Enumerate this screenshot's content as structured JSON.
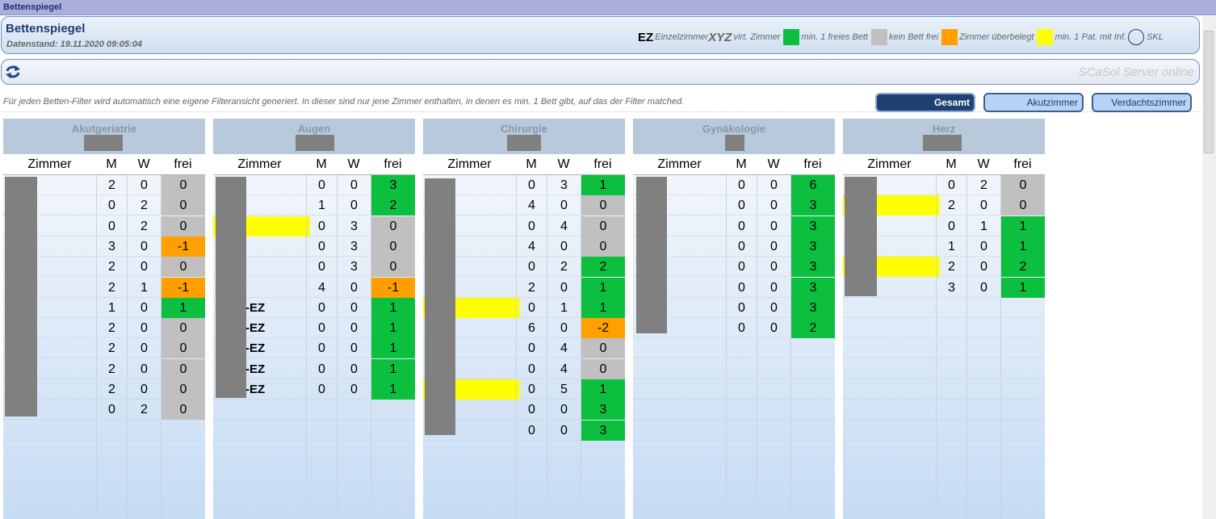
{
  "window": {
    "title": "Bettenspiegel"
  },
  "header": {
    "title": "Bettenspiegel",
    "datestand": "Datenstand: 19.11.2020 09:05:04"
  },
  "legend": {
    "ez_code": "EZ",
    "ez_label": "Einzelzimmer",
    "xyz_code": "XYZ",
    "xyz_label": "virt. Zimmer",
    "green_label": "min. 1 freies Bett",
    "gray_label": "kein Bett frei",
    "orange_label": "Zimmer überbelegt",
    "yellow_label": "min. 1 Pat. mit Inf.",
    "skl_label": "SKL",
    "colors": {
      "green": "#0cbf3f",
      "gray": "#c0c0c0",
      "orange": "#ff9f00",
      "yellow": "#ffff00"
    }
  },
  "toolbar": {
    "refresh_icon": "refresh-icon",
    "server_status": "SCaSol Server online"
  },
  "info_text": "Für jeden Betten-Filter wird automatisch eine eigene Filteransicht generiert. In dieser sind nur jene Zimmer enthalten, in denen es min. 1 Bett gibt, auf das der Filter matched.",
  "filters": {
    "gesamt": "Gesamt",
    "akutzimmer": "Akutzimmer",
    "verdachtszimmer": "Verdachtszimmer",
    "selected": "Gesamt"
  },
  "columns": {
    "room": "Zimmer",
    "m": "M",
    "w": "W",
    "free": "frei"
  },
  "wards": [
    {
      "name": "Akutgeriatrie",
      "rows": [
        {
          "m": "2",
          "w": "0",
          "free": "0",
          "status": "gray",
          "room": "",
          "inf": false
        },
        {
          "m": "0",
          "w": "2",
          "free": "0",
          "status": "gray",
          "room": "",
          "inf": false
        },
        {
          "m": "0",
          "w": "2",
          "free": "0",
          "status": "gray",
          "room": "",
          "inf": false
        },
        {
          "m": "3",
          "w": "0",
          "free": "-1",
          "status": "orange",
          "room": "",
          "inf": false
        },
        {
          "m": "2",
          "w": "0",
          "free": "0",
          "status": "gray",
          "room": "",
          "inf": false
        },
        {
          "m": "2",
          "w": "1",
          "free": "-1",
          "status": "orange",
          "room": "",
          "inf": false
        },
        {
          "m": "1",
          "w": "0",
          "free": "1",
          "status": "green",
          "room": "",
          "inf": false
        },
        {
          "m": "2",
          "w": "0",
          "free": "0",
          "status": "gray",
          "room": "",
          "inf": false
        },
        {
          "m": "2",
          "w": "0",
          "free": "0",
          "status": "gray",
          "room": "",
          "inf": false
        },
        {
          "m": "2",
          "w": "0",
          "free": "0",
          "status": "gray",
          "room": "",
          "inf": false
        },
        {
          "m": "2",
          "w": "0",
          "free": "0",
          "status": "gray",
          "room": "",
          "inf": false
        },
        {
          "m": "0",
          "w": "2",
          "free": "0",
          "status": "gray",
          "room": "",
          "inf": false
        }
      ]
    },
    {
      "name": "Augen",
      "rows": [
        {
          "m": "0",
          "w": "0",
          "free": "3",
          "status": "green",
          "room": "",
          "inf": false
        },
        {
          "m": "1",
          "w": "0",
          "free": "2",
          "status": "green",
          "room": "",
          "inf": false
        },
        {
          "m": "0",
          "w": "3",
          "free": "0",
          "status": "gray",
          "room": "",
          "inf": true
        },
        {
          "m": "0",
          "w": "3",
          "free": "0",
          "status": "gray",
          "room": "",
          "inf": false
        },
        {
          "m": "0",
          "w": "3",
          "free": "0",
          "status": "gray",
          "room": "",
          "inf": false
        },
        {
          "m": "4",
          "w": "0",
          "free": "-1",
          "status": "orange",
          "room": "",
          "inf": false
        },
        {
          "m": "0",
          "w": "0",
          "free": "1",
          "status": "green",
          "room": "-EZ",
          "inf": false
        },
        {
          "m": "0",
          "w": "0",
          "free": "1",
          "status": "green",
          "room": "-EZ",
          "inf": false
        },
        {
          "m": "0",
          "w": "0",
          "free": "1",
          "status": "green",
          "room": "-EZ",
          "inf": false
        },
        {
          "m": "0",
          "w": "0",
          "free": "1",
          "status": "green",
          "room": "-EZ",
          "inf": false
        },
        {
          "m": "0",
          "w": "0",
          "free": "1",
          "status": "green",
          "room": "-EZ",
          "inf": false
        }
      ]
    },
    {
      "name": "Chirurgie",
      "rows": [
        {
          "m": "0",
          "w": "3",
          "free": "1",
          "status": "green",
          "room": "",
          "inf": false
        },
        {
          "m": "4",
          "w": "0",
          "free": "0",
          "status": "gray",
          "room": "",
          "inf": false
        },
        {
          "m": "0",
          "w": "4",
          "free": "0",
          "status": "gray",
          "room": "",
          "inf": false
        },
        {
          "m": "4",
          "w": "0",
          "free": "0",
          "status": "gray",
          "room": "",
          "inf": false
        },
        {
          "m": "0",
          "w": "2",
          "free": "2",
          "status": "green",
          "room": "",
          "inf": false
        },
        {
          "m": "2",
          "w": "0",
          "free": "1",
          "status": "green",
          "room": "",
          "inf": false
        },
        {
          "m": "0",
          "w": "1",
          "free": "1",
          "status": "green",
          "room": "",
          "inf": true
        },
        {
          "m": "6",
          "w": "0",
          "free": "-2",
          "status": "orange",
          "room": "",
          "inf": false
        },
        {
          "m": "0",
          "w": "4",
          "free": "0",
          "status": "gray",
          "room": "",
          "inf": false
        },
        {
          "m": "0",
          "w": "4",
          "free": "0",
          "status": "gray",
          "room": "",
          "inf": false
        },
        {
          "m": "0",
          "w": "5",
          "free": "1",
          "status": "green",
          "room": "",
          "inf": true
        },
        {
          "m": "0",
          "w": "0",
          "free": "3",
          "status": "green",
          "room": "",
          "inf": false
        },
        {
          "m": "0",
          "w": "0",
          "free": "3",
          "status": "green",
          "room": "",
          "inf": false
        }
      ]
    },
    {
      "name": "Gynäkologie",
      "rows": [
        {
          "m": "0",
          "w": "0",
          "free": "6",
          "status": "green",
          "room": "",
          "inf": false
        },
        {
          "m": "0",
          "w": "0",
          "free": "3",
          "status": "green",
          "room": "",
          "inf": false
        },
        {
          "m": "0",
          "w": "0",
          "free": "3",
          "status": "green",
          "room": "",
          "inf": false
        },
        {
          "m": "0",
          "w": "0",
          "free": "3",
          "status": "green",
          "room": "",
          "inf": false
        },
        {
          "m": "0",
          "w": "0",
          "free": "3",
          "status": "green",
          "room": "",
          "inf": false
        },
        {
          "m": "0",
          "w": "0",
          "free": "3",
          "status": "green",
          "room": "",
          "inf": false
        },
        {
          "m": "0",
          "w": "0",
          "free": "3",
          "status": "green",
          "room": "",
          "inf": false
        },
        {
          "m": "0",
          "w": "0",
          "free": "2",
          "status": "green",
          "room": "",
          "inf": false
        }
      ]
    },
    {
      "name": "Herz",
      "rows": [
        {
          "m": "0",
          "w": "2",
          "free": "0",
          "status": "gray",
          "room": "",
          "inf": false
        },
        {
          "m": "2",
          "w": "0",
          "free": "0",
          "status": "gray",
          "room": "",
          "inf": true
        },
        {
          "m": "0",
          "w": "1",
          "free": "1",
          "status": "green",
          "room": "",
          "inf": false
        },
        {
          "m": "1",
          "w": "0",
          "free": "1",
          "status": "green",
          "room": "",
          "inf": false
        },
        {
          "m": "2",
          "w": "0",
          "free": "2",
          "status": "green",
          "room": "",
          "inf": true
        },
        {
          "m": "3",
          "w": "0",
          "free": "1",
          "status": "green",
          "room": "",
          "inf": false
        }
      ]
    }
  ]
}
